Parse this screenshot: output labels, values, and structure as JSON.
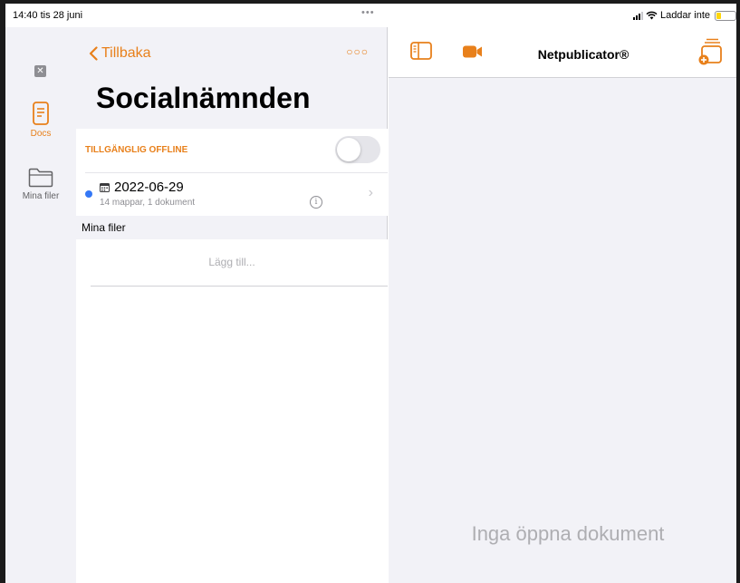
{
  "status_bar": {
    "time_date": "14:40  tis 28 juni",
    "battery_label": "Laddar inte"
  },
  "rail": {
    "items": [
      {
        "label": "Docs",
        "icon": "document-icon",
        "active": true
      },
      {
        "label": "Mina filer",
        "icon": "folder-icon",
        "active": false
      }
    ]
  },
  "list": {
    "back_label": "Tillbaka",
    "title": "Socialnämnden",
    "offline_label": "TILLGÄNGLIG OFFLINE",
    "offline_enabled": false,
    "meeting": {
      "title": "2022-06-29",
      "subtitle": "14 mappar, 1 dokument"
    },
    "section_header": "Mina filer",
    "add_label": "Lägg till..."
  },
  "detail": {
    "title": "Netpublicator®",
    "empty_message": "Inga öppna dokument"
  },
  "colors": {
    "accent": "#e8801b",
    "unread_dot": "#3478f6",
    "background": "#f2f2f7"
  }
}
